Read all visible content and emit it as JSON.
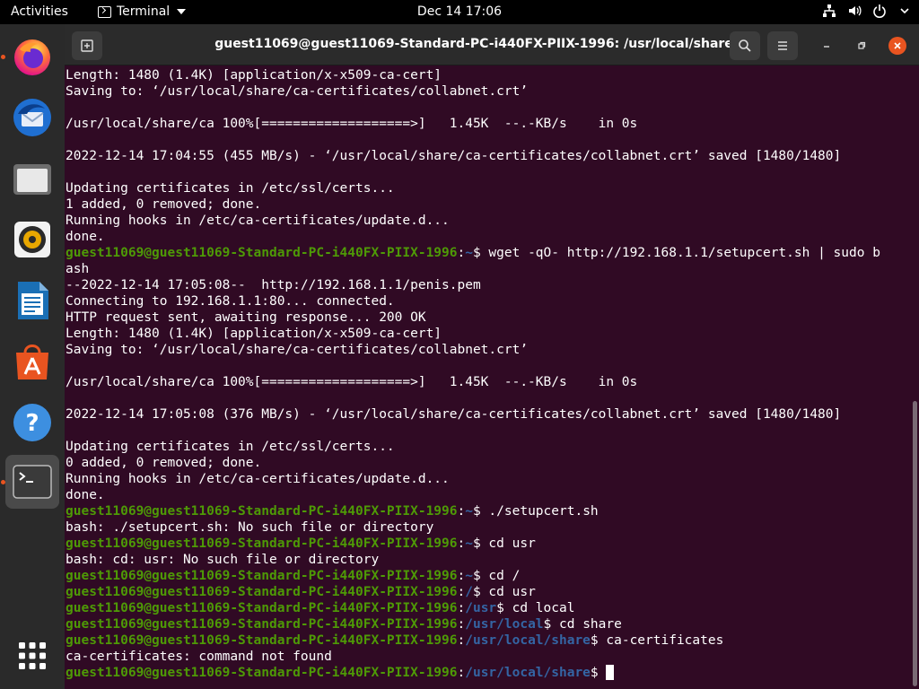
{
  "topbar": {
    "activities": "Activities",
    "app_menu": "Terminal",
    "clock": "Dec 14  17:06",
    "tray_icons": [
      "network-icon",
      "volume-icon",
      "power-icon",
      "chevron-down-icon"
    ]
  },
  "dock": {
    "items": [
      {
        "name": "firefox",
        "running": true
      },
      {
        "name": "thunderbird",
        "running": false
      },
      {
        "name": "files",
        "running": false
      },
      {
        "name": "rhythmbox",
        "running": false
      },
      {
        "name": "libreoffice-writer",
        "running": false
      },
      {
        "name": "ubuntu-software",
        "running": false
      },
      {
        "name": "help",
        "running": false
      },
      {
        "name": "terminal",
        "running": true,
        "active": true
      }
    ],
    "show_apps": "show-applications-icon"
  },
  "window": {
    "title": "guest11069@guest11069-Standard-PC-i440FX-PIIX-1996: /usr/local/share",
    "controls": [
      "new-tab-icon",
      "search-icon",
      "menu-icon",
      "minimize-icon",
      "maximize-icon",
      "close-icon"
    ]
  },
  "terminal": {
    "lines": [
      {
        "t": "Length: 1480 (1.4K) [application/x-x509-ca-cert]"
      },
      {
        "t": "Saving to: ‘/usr/local/share/ca-certificates/collabnet.crt’"
      },
      {
        "t": ""
      },
      {
        "t": "/usr/local/share/ca 100%[===================>]   1.45K  --.-KB/s    in 0s"
      },
      {
        "t": ""
      },
      {
        "t": "2022-12-14 17:04:55 (455 MB/s) - ‘/usr/local/share/ca-certificates/collabnet.crt’ saved [1480/1480]"
      },
      {
        "t": ""
      },
      {
        "t": "Updating certificates in /etc/ssl/certs..."
      },
      {
        "t": "1 added, 0 removed; done."
      },
      {
        "t": "Running hooks in /etc/ca-certificates/update.d..."
      },
      {
        "t": "done."
      },
      {
        "u": "guest11069@guest11069-Standard-PC-i440FX-PIIX-1996",
        "p": "~",
        "c": " wget -qO- http://192.168.1.1/setupcert.sh | sudo b"
      },
      {
        "t": "ash"
      },
      {
        "t": "--2022-12-14 17:05:08--  http://192.168.1.1/penis.pem"
      },
      {
        "t": "Connecting to 192.168.1.1:80... connected."
      },
      {
        "t": "HTTP request sent, awaiting response... 200 OK"
      },
      {
        "t": "Length: 1480 (1.4K) [application/x-x509-ca-cert]"
      },
      {
        "t": "Saving to: ‘/usr/local/share/ca-certificates/collabnet.crt’"
      },
      {
        "t": ""
      },
      {
        "t": "/usr/local/share/ca 100%[===================>]   1.45K  --.-KB/s    in 0s"
      },
      {
        "t": ""
      },
      {
        "t": "2022-12-14 17:05:08 (376 MB/s) - ‘/usr/local/share/ca-certificates/collabnet.crt’ saved [1480/1480]"
      },
      {
        "t": ""
      },
      {
        "t": "Updating certificates in /etc/ssl/certs..."
      },
      {
        "t": "0 added, 0 removed; done."
      },
      {
        "t": "Running hooks in /etc/ca-certificates/update.d..."
      },
      {
        "t": "done."
      },
      {
        "u": "guest11069@guest11069-Standard-PC-i440FX-PIIX-1996",
        "p": "~",
        "c": " ./setupcert.sh"
      },
      {
        "t": "bash: ./setupcert.sh: No such file or directory"
      },
      {
        "u": "guest11069@guest11069-Standard-PC-i440FX-PIIX-1996",
        "p": "~",
        "c": " cd usr"
      },
      {
        "t": "bash: cd: usr: No such file or directory"
      },
      {
        "u": "guest11069@guest11069-Standard-PC-i440FX-PIIX-1996",
        "p": "~",
        "c": " cd /"
      },
      {
        "u": "guest11069@guest11069-Standard-PC-i440FX-PIIX-1996",
        "p": "/",
        "c": " cd usr"
      },
      {
        "u": "guest11069@guest11069-Standard-PC-i440FX-PIIX-1996",
        "p": "/usr",
        "c": " cd local"
      },
      {
        "u": "guest11069@guest11069-Standard-PC-i440FX-PIIX-1996",
        "p": "/usr/local",
        "c": " cd share"
      },
      {
        "u": "guest11069@guest11069-Standard-PC-i440FX-PIIX-1996",
        "p": "/usr/local/share",
        "c": " ca-certificates"
      },
      {
        "t": "ca-certificates: command not found"
      },
      {
        "u": "guest11069@guest11069-Standard-PC-i440FX-PIIX-1996",
        "p": "/usr/local/share",
        "c": " ",
        "cursor": true
      }
    ]
  },
  "colors": {
    "terminal_bg": "#300a24",
    "prompt_user": "#4e9a06",
    "prompt_path": "#3465a4",
    "accent": "#e95420"
  }
}
